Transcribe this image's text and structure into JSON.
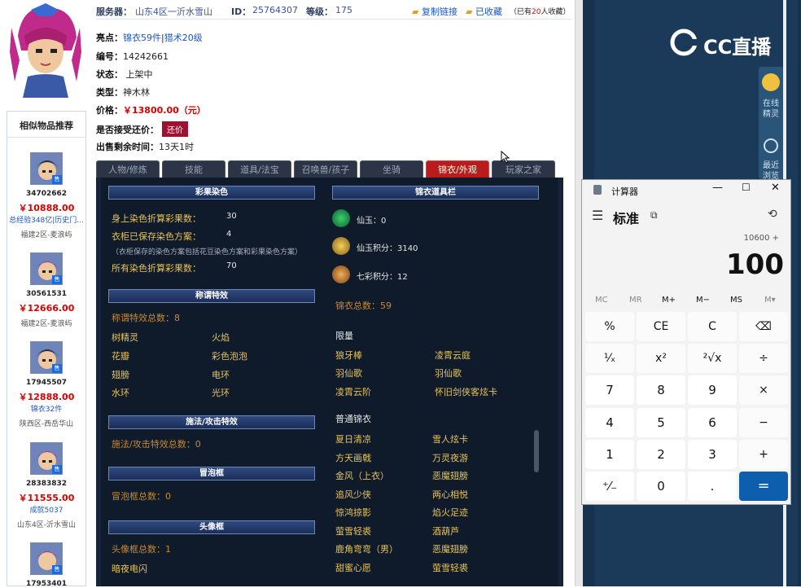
{
  "seller": {
    "server_label": "服务器：",
    "server": "山东4区一沂水雪山",
    "id_label": "ID：",
    "id": "25764307",
    "level_label": "等级：",
    "level": "175",
    "copy_link": "复制链接",
    "favorited": "已收藏",
    "fav_count_prefix": "（已有",
    "fav_count": "20",
    "fav_count_suffix": "人收藏）"
  },
  "item": {
    "highlights_label": "亮点：",
    "highlights_a": "锦衣59件",
    "highlights_sep": "|",
    "highlights_b": "猎术20级",
    "number_label": "编号：",
    "number": "14242661",
    "status_label": "状态：",
    "status": "上架中",
    "type_label": "类型：",
    "type": "神木林",
    "price_label": "价格：",
    "price": "￥13800.00（元）",
    "bargain_label": "是否接受还价：",
    "bargain_btn": "还价",
    "time_label": "出售剩余时间：",
    "time": "13天1时"
  },
  "tabs": [
    "人物/修炼",
    "技能",
    "道具/法宝",
    "召唤兽/孩子",
    "坐骑",
    "锦衣/外观",
    "玩家之家"
  ],
  "active_tab": "锦衣/外观",
  "panel": {
    "dye_header": "彩果染色",
    "dye_body_label": "身上染色折算彩果数：",
    "dye_body": "30",
    "dye_wardrobe_label": "衣柜已保存染色方案：",
    "dye_wardrobe": "4",
    "dye_note": "（衣柜保存的染色方案包括花豆染色方案和彩果染色方案）",
    "dye_total_label": "所有染色折算彩果数：",
    "dye_total": "70",
    "title_header": "称谓特效",
    "title_total": "称谓特效总数：8",
    "titles": [
      "树精灵",
      "火焰",
      "花瓣",
      "彩色泡泡",
      "翅膀",
      "电环",
      "水环",
      "光环"
    ],
    "spell_header": "施法/攻击特效",
    "spell_total": "施法/攻击特效总数：0",
    "bubble_header": "冒泡框",
    "bubble_total": "冒泡框总数：0",
    "head_header": "头像框",
    "head_total": "头像框总数：1",
    "head_item": "暗夜电闪",
    "jinyi_header": "锦衣道具栏",
    "xianyu": "仙玉：0",
    "xianyu_points": "仙玉积分：3140",
    "qicai_points": "七彩积分：12",
    "jinyi_total": "锦衣总数：59",
    "limited_label": "限量",
    "limited": [
      "狼牙棒",
      "凌霄云庭",
      "羽仙歌",
      "羽仙歌",
      "凌霄云阶",
      "怀旧剑侠客炫卡"
    ],
    "normal_label": "普通锦衣",
    "normal": [
      "夏日清凉",
      "雪人炫卡",
      "方天画戟",
      "万灵夜游",
      "金风（上衣）",
      "恶魔翅膀",
      "追风少侠",
      "两心相悦",
      "惊鸿掠影",
      "焰火足迹",
      "萤雪轻裘",
      "酒葫芦",
      "鹿角弯弯（男）",
      "恶魔翅膀",
      "甜蜜心愿",
      "萤雪轻裘"
    ]
  },
  "sidebar": {
    "title": "相似物品推荐",
    "items": [
      {
        "id": "34702662",
        "price": "￥10888.00",
        "tag": "总经验348亿|历史门...",
        "server": "福建2区-麦浪屿"
      },
      {
        "id": "30561531",
        "price": "￥12666.00",
        "tag": "",
        "server": "福建2区-麦浪屿"
      },
      {
        "id": "17945507",
        "price": "￥12888.00",
        "tag": "锦衣32件",
        "server": "陕西区-西岳华山"
      },
      {
        "id": "28383832",
        "price": "￥11555.00",
        "tag": "成就5037",
        "server": "山东4区-沂水雪山"
      },
      {
        "id": "17953401",
        "price": "",
        "tag": "",
        "server": ""
      }
    ],
    "badge": "售"
  },
  "cc": {
    "logo": "CC直播",
    "online_label_1": "在线",
    "online_label_2": "精灵",
    "recent_label_1": "最近",
    "recent_label_2": "浏览"
  },
  "calculator": {
    "title": "计算器",
    "mode": "标准",
    "expression": "10600 +",
    "display": "100",
    "memory": [
      "MC",
      "MR",
      "M+",
      "M−",
      "MS",
      "M▾"
    ],
    "keys": [
      "%",
      "CE",
      "C",
      "⌫",
      "¹⁄ₓ",
      "x²",
      "²√x",
      "÷",
      "7",
      "8",
      "9",
      "×",
      "4",
      "5",
      "6",
      "−",
      "1",
      "2",
      "3",
      "+",
      "⁺⁄₋",
      "0",
      ".",
      "="
    ]
  }
}
